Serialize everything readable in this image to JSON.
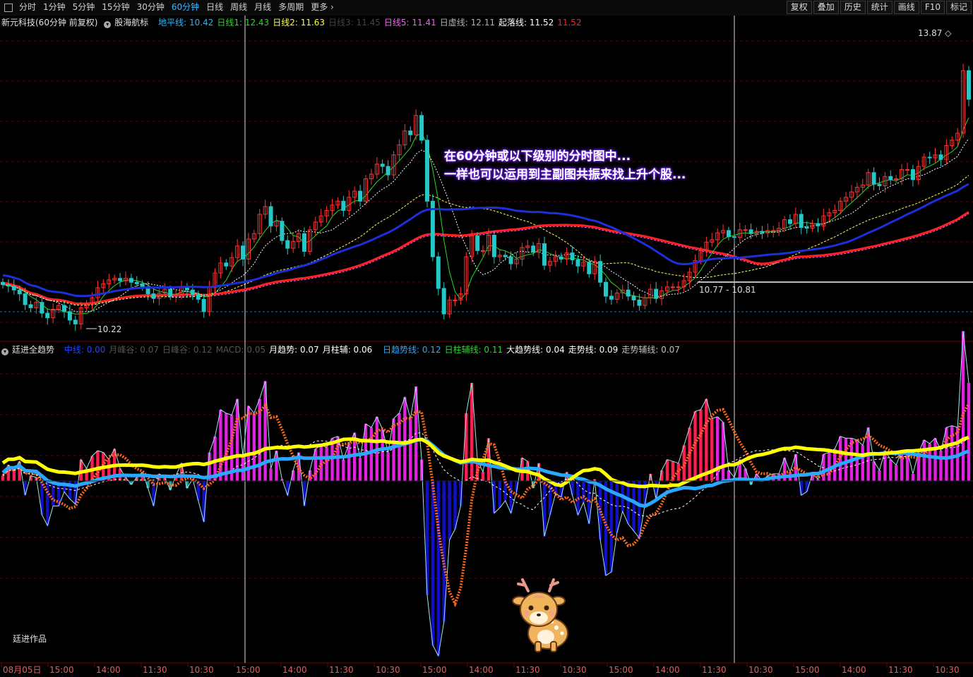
{
  "toolbar": {
    "periods": [
      "分时",
      "1分钟",
      "5分钟",
      "15分钟",
      "30分钟",
      "60分钟",
      "日线",
      "周线",
      "月线",
      "多周期",
      "更多"
    ],
    "active_period": "60分钟",
    "right_buttons": [
      "复权",
      "叠加",
      "历史",
      "统计",
      "画线",
      "F10",
      "标记"
    ]
  },
  "main_legend": {
    "stock": "新元科技(60分钟 前复权)",
    "indicator": "股海航标",
    "items": [
      {
        "text": "地平线: 10.42",
        "color": "#29b6f6"
      },
      {
        "text": "日线1: 12.43",
        "color": "#22dd22"
      },
      {
        "text": "日线2: 11.63",
        "color": "#ffff33"
      },
      {
        "text": "日线3: 11.45",
        "color": "#444444"
      },
      {
        "text": "日线5: 11.41",
        "color": "#ff55ff"
      },
      {
        "text": "日虚线: 12.11",
        "color": "#b0b0b0"
      },
      {
        "text": "起落线: 11.52",
        "color": "#ffffff"
      },
      {
        "text": "11.52",
        "color": "#ff2222"
      }
    ]
  },
  "sub_legend": {
    "indicator": "廷进全趋势",
    "items": [
      {
        "text": "中线: 0.00",
        "color": "#2244ff"
      },
      {
        "text": "月峰谷: 0.07",
        "color": "#555555"
      },
      {
        "text": "日峰谷: 0.12",
        "color": "#555555"
      },
      {
        "text": "MACD: 0.05",
        "color": "#555555"
      },
      {
        "text": "月趋势: 0.07",
        "color": "#ffffff"
      },
      {
        "text": "月柱辅: 0.06",
        "color": "#ffffff"
      }
    ],
    "items2": [
      {
        "text": "日趋势线: 0.12",
        "color": "#29a8ff"
      },
      {
        "text": "日柱辅线: 0.11",
        "color": "#22dd22"
      },
      {
        "text": "大趋势线: 0.04",
        "color": "#ffffff"
      },
      {
        "text": "走势线: 0.09",
        "color": "#ffffff"
      },
      {
        "text": "走势辅线: 0.07",
        "color": "#c0c0c0"
      }
    ]
  },
  "annotation": {
    "line1": "在60分钟或以下级别的分时图中...",
    "line2": "一样也可以运用到主副图共振来找上升个股..."
  },
  "watermark": "廷进作品",
  "chart_data": {
    "type": "candlestick",
    "price_labels": {
      "high": "13.87",
      "low": "10.22",
      "range": "10.77 - 10.81"
    },
    "time_axis": [
      "08月05日",
      "15:00",
      "14:00",
      "11:30",
      "10:30",
      "15:00",
      "14:00",
      "11:30",
      "10:30",
      "15:00",
      "14:00",
      "11:30",
      "10:30",
      "15:00",
      "14:00",
      "11:30",
      "10:30",
      "15:00",
      "14:00",
      "11:30",
      "10:30"
    ],
    "price_ylim": [
      10.1,
      14.1
    ],
    "closes": [
      10.78,
      10.76,
      10.71,
      10.66,
      10.52,
      10.48,
      10.55,
      10.41,
      10.35,
      10.46,
      10.51,
      10.43,
      10.32,
      10.27,
      10.48,
      10.53,
      10.61,
      10.74,
      10.79,
      10.84,
      10.86,
      10.83,
      10.86,
      10.81,
      10.79,
      10.75,
      10.66,
      10.6,
      10.67,
      10.72,
      10.63,
      10.65,
      10.74,
      10.71,
      10.65,
      10.59,
      10.43,
      10.74,
      10.93,
      11.06,
      11.02,
      11.13,
      11.28,
      11.11,
      11.37,
      11.44,
      11.69,
      11.79,
      11.54,
      11.6,
      11.35,
      11.25,
      11.34,
      11.44,
      11.21,
      11.49,
      11.59,
      11.67,
      11.74,
      11.81,
      11.86,
      11.74,
      11.91,
      11.99,
      11.86,
      12.15,
      12.21,
      12.34,
      12.31,
      12.2,
      12.46,
      12.59,
      12.77,
      12.72,
      12.97,
      12.65,
      11.86,
      11.14,
      10.73,
      10.4,
      10.58,
      10.58,
      10.66,
      11.14,
      11.41,
      11.22,
      11.22,
      11.42,
      11.14,
      11.16,
      11.14,
      11.05,
      11.11,
      11.26,
      11.28,
      11.2,
      11.31,
      11.03,
      11.08,
      11.14,
      11.11,
      11.19,
      11.1,
      11.02,
      11.07,
      10.92,
      11.08,
      10.81,
      10.63,
      10.59,
      10.67,
      10.71,
      10.63,
      10.58,
      10.51,
      10.61,
      10.72,
      10.6,
      10.7,
      10.75,
      10.75,
      10.75,
      10.83,
      10.94,
      11.09,
      11.22,
      11.33,
      11.36,
      11.45,
      11.48,
      11.4,
      11.39,
      11.49,
      11.49,
      11.44,
      11.47,
      11.45,
      11.48,
      11.48,
      11.51,
      11.62,
      11.57,
      11.69,
      11.52,
      11.51,
      11.57,
      11.54,
      11.67,
      11.71,
      11.74,
      11.86,
      11.91,
      11.98,
      12.04,
      12.07,
      12.23,
      12.08,
      12.06,
      12.18,
      12.14,
      12.15,
      12.27,
      12.27,
      12.14,
      12.31,
      12.43,
      12.42,
      12.46,
      12.4,
      12.58,
      12.65,
      12.74,
      13.55,
      13.18
    ],
    "macd_ylim": [
      -1.0,
      0.7
    ],
    "macd": [
      0.03,
      0.09,
      0.06,
      0.11,
      -0.08,
      0.03,
      0.02,
      -0.19,
      -0.25,
      -0.14,
      -0.14,
      -0.06,
      -0.1,
      -0.13,
      0.12,
      0.07,
      0.14,
      0.17,
      0.16,
      0.12,
      0.18,
      0.07,
      0.02,
      -0.02,
      0.02,
      0.05,
      -0.04,
      -0.14,
      0.04,
      0.02,
      -0.05,
      0.03,
      0.1,
      -0.04,
      0.01,
      -0.11,
      -0.23,
      0.16,
      0.25,
      0.4,
      0.38,
      0.37,
      0.46,
      0.14,
      0.42,
      0.38,
      0.46,
      0.56,
      0.07,
      0.17,
      0.01,
      -0.08,
      0.06,
      0.16,
      -0.14,
      0.06,
      0.18,
      0.2,
      0.19,
      0.24,
      0.25,
      0.12,
      0.21,
      0.27,
      0.13,
      0.32,
      0.3,
      0.36,
      0.29,
      0.16,
      0.35,
      0.38,
      0.47,
      0.35,
      0.53,
      0.12,
      -0.64,
      -0.92,
      -0.98,
      -0.79,
      -0.33,
      -0.27,
      -0.14,
      0.38,
      0.55,
      0.12,
      0.05,
      0.24,
      -0.18,
      -0.15,
      -0.11,
      -0.18,
      -0.06,
      0.13,
      0.11,
      -0.04,
      0.1,
      -0.31,
      -0.19,
      -0.07,
      -0.09,
      0.05,
      -0.08,
      -0.19,
      -0.12,
      -0.24,
      0.01,
      -0.33,
      -0.53,
      -0.51,
      -0.29,
      -0.17,
      -0.24,
      -0.28,
      -0.32,
      -0.13,
      0.04,
      -0.1,
      0.06,
      0.12,
      0.11,
      0.1,
      0.2,
      0.3,
      0.39,
      0.4,
      0.46,
      0.35,
      0.36,
      0.33,
      0.06,
      0.02,
      0.12,
      0.07,
      -0.02,
      0.04,
      0.0,
      0.03,
      0.04,
      0.04,
      0.13,
      0.05,
      0.15,
      -0.08,
      -0.06,
      0.04,
      0.01,
      0.15,
      0.16,
      0.18,
      0.25,
      0.24,
      0.24,
      0.23,
      0.2,
      0.3,
      0.11,
      0.06,
      0.17,
      0.12,
      0.09,
      0.17,
      0.17,
      0.04,
      0.16,
      0.23,
      0.21,
      0.24,
      0.17,
      0.3,
      0.31,
      0.3,
      0.84,
      0.55
    ]
  }
}
